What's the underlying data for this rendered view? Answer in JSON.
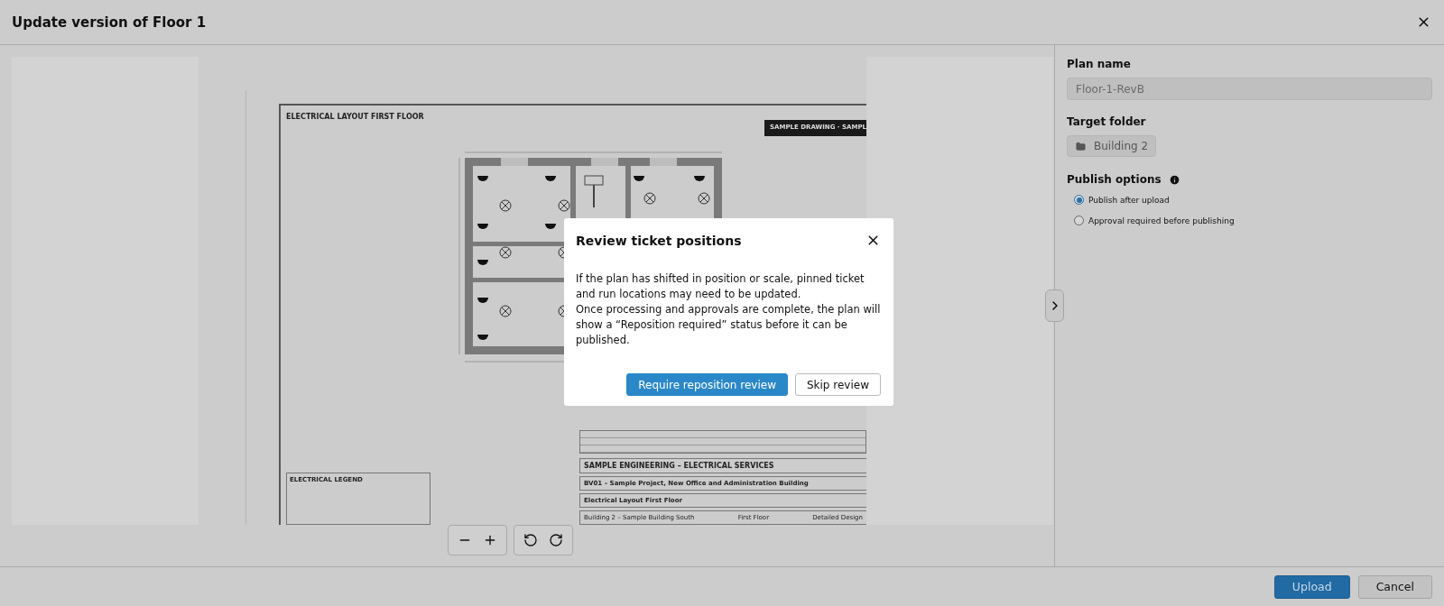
{
  "window": {
    "title": "Update version of Floor 1"
  },
  "document": {
    "title": "ELECTRICAL LAYOUT FIRST FLOOR",
    "stamp": "SAMPLE DRAWING · SAMPL",
    "legend_title": "ELECTRICAL LEGEND",
    "company": "SAMPLE ENGINEERING – ELECTRICAL SERVICES",
    "project": "BV01 – Sample Project, New Office and Administration Building",
    "drawing_title": "Electrical Layout First Floor",
    "building": "Building 2 – Sample Building South",
    "level": "First Floor",
    "phase": "Detailed Design"
  },
  "side_panel": {
    "plan_name": {
      "label": "Plan name",
      "value": "Floor-1-RevB",
      "disabled": true
    },
    "target_folder": {
      "label": "Target folder",
      "value": "Building 2"
    },
    "publish_options": {
      "label": "Publish options",
      "options": [
        {
          "label": "Publish after upload",
          "selected": true
        },
        {
          "label": "Approval required before publishing",
          "selected": false
        }
      ]
    }
  },
  "dialog": {
    "title": "Review ticket positions",
    "paragraphs": [
      "If the plan has shifted in position or scale, pinned ticket and run locations may need to be updated.",
      "Once processing and approvals are complete, the plan will show a “Reposition required” status before it can be published."
    ],
    "buttons": [
      {
        "label": "Require reposition review",
        "kind": "primary"
      },
      {
        "label": "Skip review",
        "kind": "secondary"
      }
    ]
  },
  "footer": {
    "buttons": [
      {
        "label": "Upload",
        "kind": "primary"
      },
      {
        "label": "Cancel",
        "kind": "secondary"
      }
    ]
  }
}
